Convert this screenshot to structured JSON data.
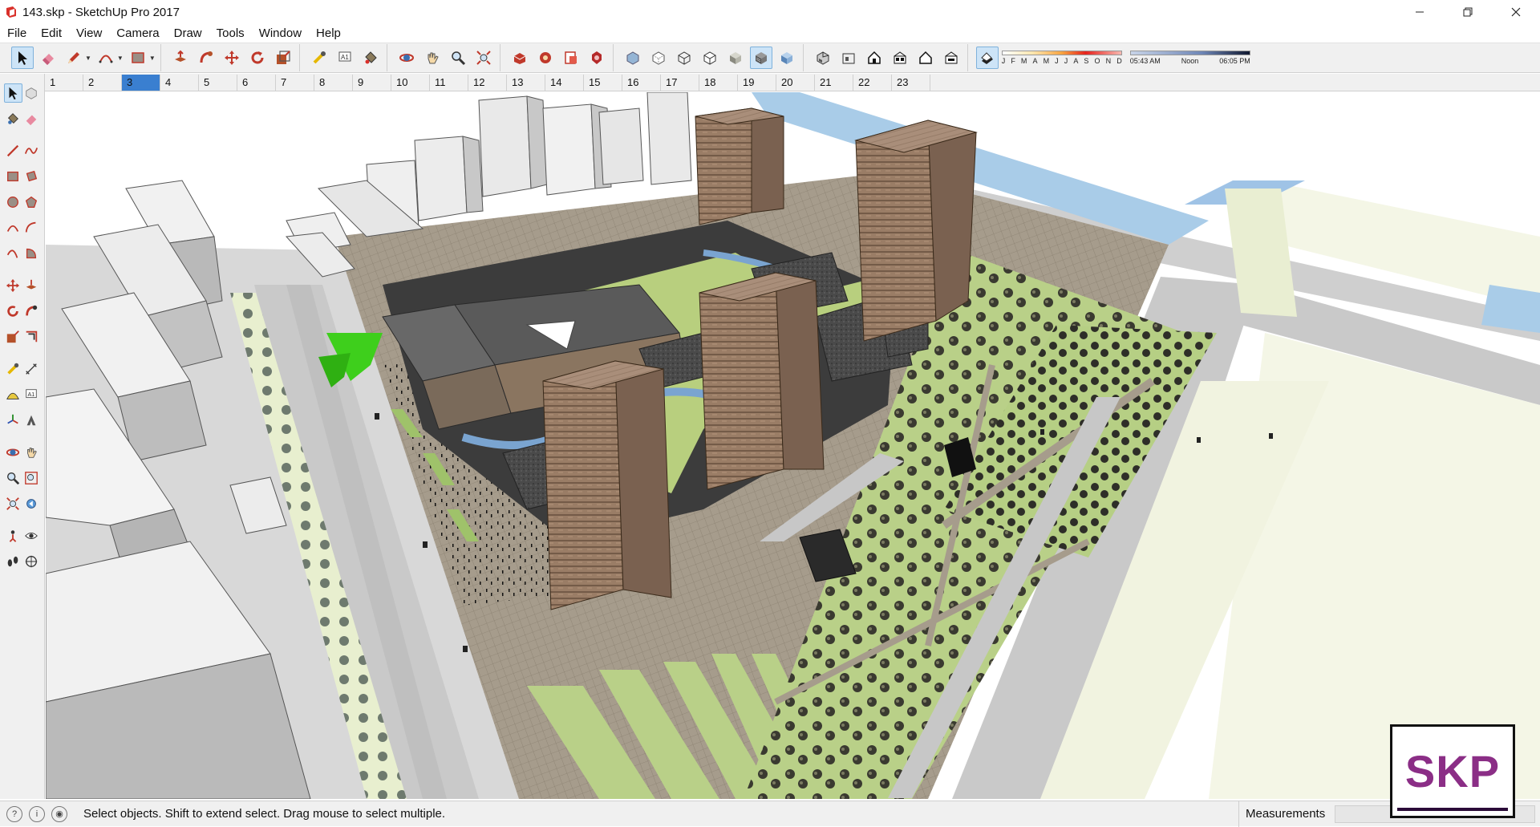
{
  "window": {
    "title": "143.skp - SketchUp Pro 2017",
    "controls": [
      "minimize-icon",
      "restore-icon",
      "close-icon"
    ]
  },
  "menu": [
    "File",
    "Edit",
    "View",
    "Camera",
    "Draw",
    "Tools",
    "Window",
    "Help"
  ],
  "toolbar": {
    "groups": [
      [
        "select-icon",
        "eraser-icon",
        "pencil-icon",
        "arc-icon",
        "rectangle-icon"
      ],
      [
        "push-pull-icon",
        "follow-me-icon",
        "move-icon",
        "rotate-icon",
        "scale-icon"
      ],
      [
        "tape-measure-icon",
        "text-icon",
        "paint-bucket-icon"
      ],
      [
        "orbit-icon",
        "pan-icon",
        "zoom-icon",
        "zoom-extents-icon"
      ],
      [
        "warehouse-icon",
        "extension-warehouse-icon",
        "send-to-layout-icon",
        "extension-manager-icon"
      ],
      [
        "xray-icon",
        "back-edges-icon",
        "wireframe-icon",
        "hidden-line-icon",
        "shaded-icon",
        "shaded-textures-icon",
        "monochrome-icon"
      ],
      [
        "iso-view-icon",
        "top-view-icon",
        "front-view-icon",
        "right-view-icon",
        "back-view-icon",
        "left-view-icon"
      ],
      [
        "shadows-toggle-icon"
      ]
    ],
    "shadow": {
      "months": [
        "J",
        "F",
        "M",
        "A",
        "M",
        "J",
        "J",
        "A",
        "S",
        "O",
        "N",
        "D"
      ],
      "time_start": "05:43 AM",
      "time_mid": "Noon",
      "time_end": "06:05 PM"
    }
  },
  "scenes": {
    "tabs": [
      "1",
      "2",
      "3",
      "4",
      "5",
      "6",
      "7",
      "8",
      "9",
      "10",
      "11",
      "12",
      "13",
      "14",
      "15",
      "16",
      "17",
      "18",
      "19",
      "20",
      "21",
      "22",
      "23"
    ],
    "active": "3"
  },
  "left_tools": [
    [
      "select-icon",
      "make-component-icon"
    ],
    [
      "paint-bucket-icon",
      "eraser-icon"
    ],
    [
      "line-icon",
      "freehand-icon"
    ],
    [
      "rectangle-icon",
      "rotated-rectangle-icon"
    ],
    [
      "circle-icon",
      "polygon-icon"
    ],
    [
      "arc-icon",
      "two-point-arc-icon"
    ],
    [
      "three-point-arc-icon",
      "pie-icon"
    ],
    [
      "move-icon",
      "push-pull-icon"
    ],
    [
      "rotate-icon",
      "follow-me-icon"
    ],
    [
      "scale-icon",
      "offset-icon"
    ],
    [
      "tape-measure-icon",
      "dimension-icon"
    ],
    [
      "protractor-icon",
      "text-icon"
    ],
    [
      "axes-icon",
      "3d-text-icon"
    ],
    [
      "orbit-icon",
      "pan-icon"
    ],
    [
      "zoom-icon",
      "zoom-window-icon"
    ],
    [
      "zoom-extents-icon",
      "previous-view-icon"
    ],
    [
      "position-camera-icon",
      "look-around-icon"
    ],
    [
      "walk-icon",
      "section-plane-icon"
    ]
  ],
  "status": {
    "message": "Select objects. Shift to extend select. Drag mouse to select multiple.",
    "measurements_label": "Measurements",
    "measurements_value": ""
  },
  "watermark": {
    "text": "SKP"
  }
}
